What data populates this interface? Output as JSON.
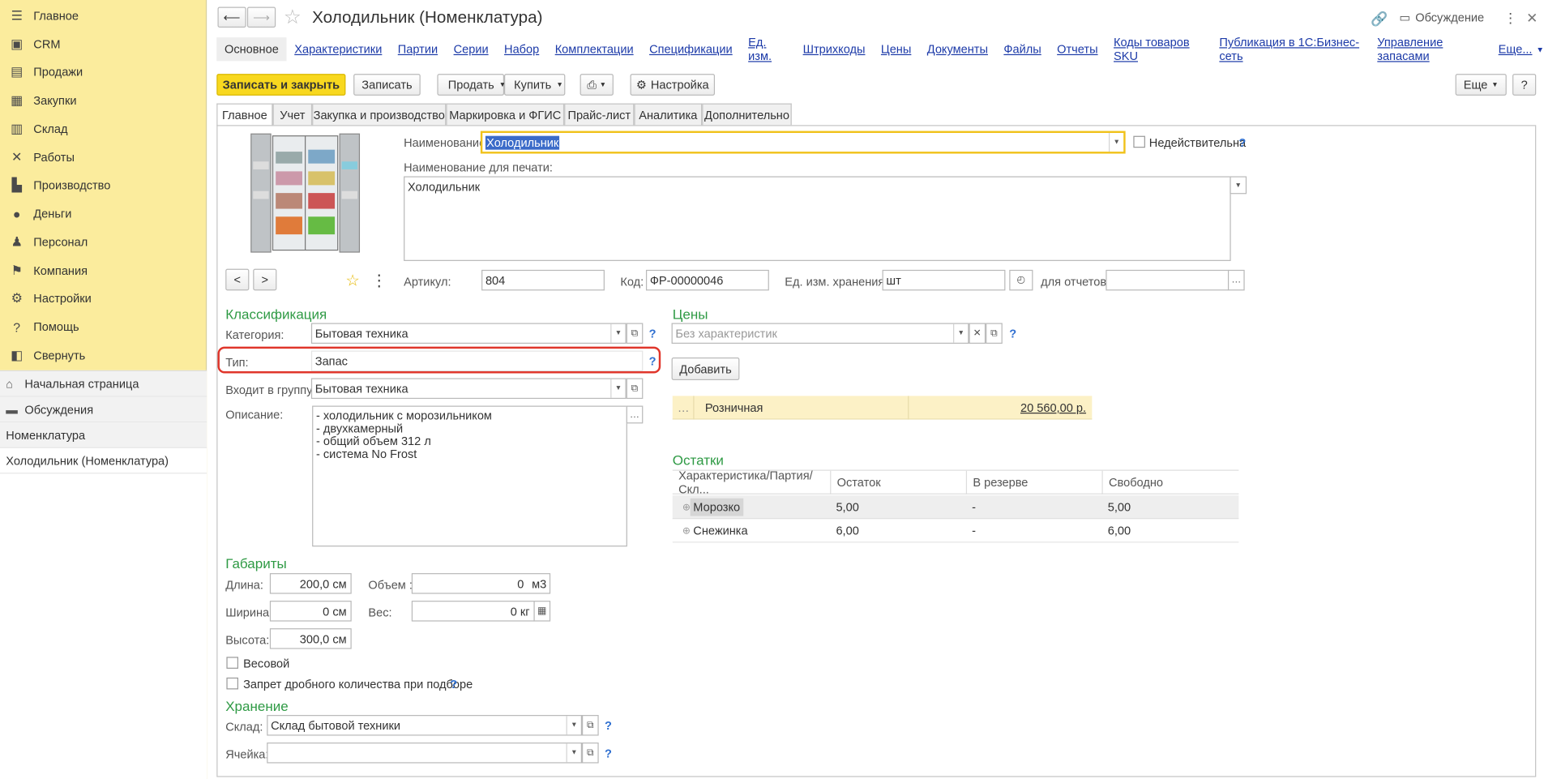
{
  "sidebar": {
    "items": [
      {
        "label": "Главное",
        "icon": "menu-icon"
      },
      {
        "label": "CRM",
        "icon": "crm-icon"
      },
      {
        "label": "Продажи",
        "icon": "sales-icon"
      },
      {
        "label": "Закупки",
        "icon": "purchases-icon"
      },
      {
        "label": "Склад",
        "icon": "warehouse-icon"
      },
      {
        "label": "Работы",
        "icon": "tools-icon"
      },
      {
        "label": "Производство",
        "icon": "factory-icon"
      },
      {
        "label": "Деньги",
        "icon": "money-icon"
      },
      {
        "label": "Персонал",
        "icon": "person-icon"
      },
      {
        "label": "Компания",
        "icon": "flag-icon"
      },
      {
        "label": "Настройки",
        "icon": "gear-icon"
      },
      {
        "label": "Помощь",
        "icon": "help-icon"
      },
      {
        "label": "Свернуть",
        "icon": "collapse-icon"
      }
    ],
    "open_pages": [
      "Начальная страница",
      "Обсуждения",
      "Номенклатура",
      "Холодильник (Номенклатура)"
    ]
  },
  "header": {
    "title": "Холодильник (Номенклатура)",
    "discuss_label": "Обсуждение"
  },
  "links": [
    "Основное",
    "Характеристики",
    "Партии",
    "Серии",
    "Набор",
    "Комплектации",
    "Спецификации",
    "Ед. изм.",
    "Штрихкоды",
    "Цены",
    "Документы",
    "Файлы",
    "Отчеты",
    "Коды товаров SKU",
    "Публикация в 1С:Бизнес-сеть",
    "Управление запасами",
    "Еще..."
  ],
  "toolbar": {
    "save_close": "Записать и закрыть",
    "save": "Записать",
    "sell": "Продать",
    "buy": "Купить",
    "settings": "Настройка",
    "more": "Еще",
    "help": "?"
  },
  "tabs": [
    "Главное",
    "Учет",
    "Закупка и производство",
    "Маркировка и ФГИС",
    "Прайс-лист",
    "Аналитика",
    "Дополнительно"
  ],
  "form": {
    "name_label": "Наименование:",
    "name_value": "Холодильник",
    "invalid_label": "Недействительна",
    "print_name_label": "Наименование для печати:",
    "print_name_value": "Холодильник",
    "article_label": "Артикул:",
    "article_value": "804",
    "code_label": "Код:",
    "code_value": "ФР-00000046",
    "unit_label": "Ед. изм. хранения:",
    "unit_value": "шт",
    "reports_label": "для отчетов:",
    "reports_value": "",
    "classification_title": "Классификация",
    "category_label": "Категория:",
    "category_value": "Бытовая техника",
    "type_label": "Тип:",
    "type_value": "Запас",
    "group_label": "Входит в группу:",
    "group_value": "Бытовая техника",
    "description_label": "Описание:",
    "description_lines": [
      "- холодильник с морозильником",
      "- двухкамерный",
      "- общий объем 312 л",
      "- система No Frost"
    ],
    "dimensions_title": "Габариты",
    "length_label": "Длина:",
    "length_value": "200,0 см",
    "volume_label": "Объем :",
    "volume_value": "0",
    "volume_unit": "м3",
    "width_label": "Ширина:",
    "width_value": "0 см",
    "weight_label": "Вес:",
    "weight_value": "0 кг",
    "height_label": "Высота:",
    "height_value": "300,0 см",
    "weighted_label": "Весовой",
    "fraction_label": "Запрет дробного количества при подборе",
    "storage_title": "Хранение",
    "warehouse_label": "Склад:",
    "warehouse_value": "Склад бытовой техники",
    "cell_label": "Ячейка:",
    "cell_value": ""
  },
  "prices": {
    "title": "Цены",
    "characteristic_placeholder": "Без характеристик",
    "add_button": "Добавить",
    "rows": [
      {
        "name": "Розничная",
        "value": "20 560,00   р."
      }
    ]
  },
  "stock": {
    "title": "Остатки",
    "columns": [
      "Характеристика/Партия/Скл...",
      "Остаток",
      "В резерве",
      "Свободно"
    ],
    "rows": [
      {
        "name": "Морозко",
        "qty": "5,00",
        "reserved": "-",
        "free": "5,00"
      },
      {
        "name": "Снежинка",
        "qty": "6,00",
        "reserved": "-",
        "free": "6,00"
      }
    ]
  },
  "colors": {
    "sidebar": "#fbec9d",
    "primary_button": "#f8d81f",
    "highlight": "#e0362b",
    "section": "#2e9a44",
    "link": "#1c3aa8"
  }
}
